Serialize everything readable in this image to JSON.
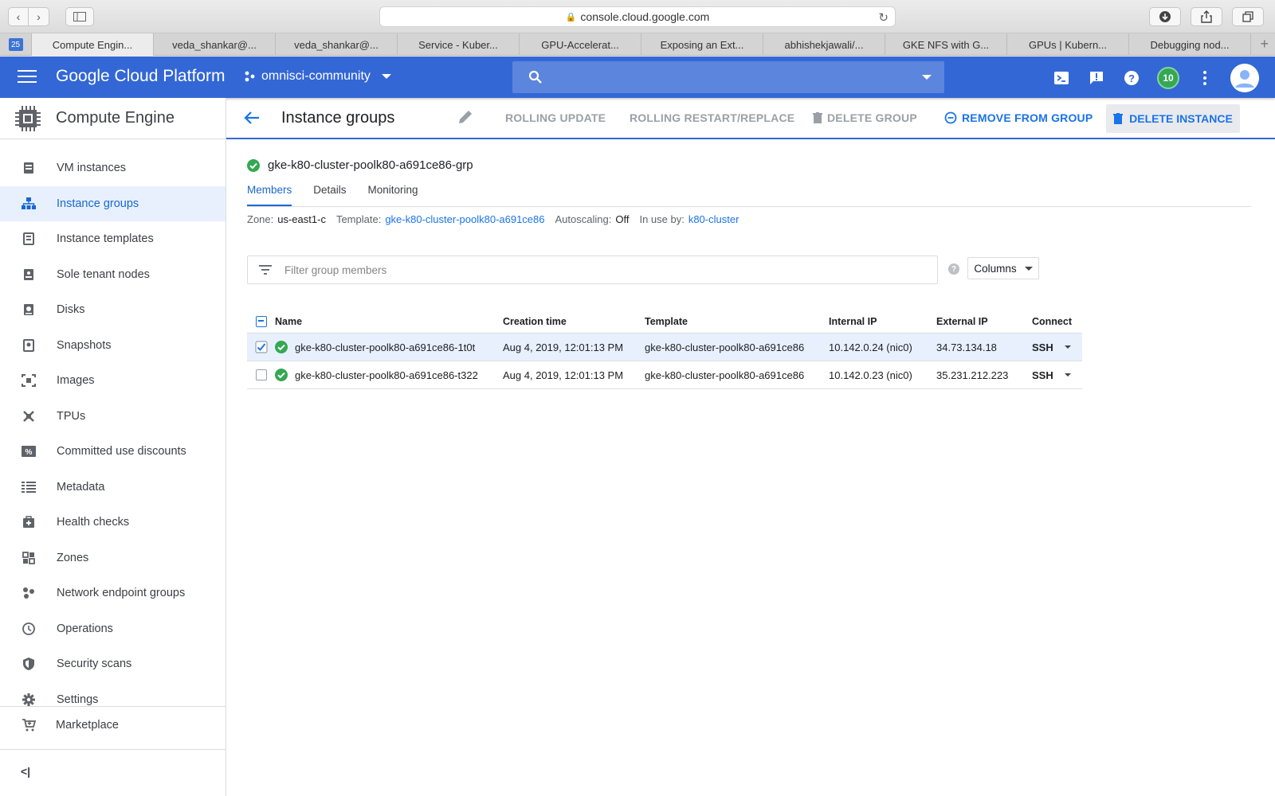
{
  "browser": {
    "url": "console.cloud.google.com",
    "fav_badge": "25",
    "tabs": [
      {
        "label": "Compute Engin..."
      },
      {
        "label": "veda_shankar@..."
      },
      {
        "label": "veda_shankar@..."
      },
      {
        "label": "Service - Kuber..."
      },
      {
        "label": "GPU-Accelerat..."
      },
      {
        "label": "Exposing an Ext..."
      },
      {
        "label": "abhishekjawali/..."
      },
      {
        "label": "GKE NFS with G..."
      },
      {
        "label": "GPUs  |  Kubern..."
      },
      {
        "label": "Debugging nod..."
      }
    ]
  },
  "header": {
    "brand": "Google Cloud Platform",
    "project": "omnisci-community",
    "notification_count": "10",
    "accent_color": "#3367d6"
  },
  "sidebar": {
    "title": "Compute Engine",
    "items": [
      {
        "label": "VM instances",
        "icon": "vm-instances-icon"
      },
      {
        "label": "Instance groups",
        "icon": "instance-groups-icon"
      },
      {
        "label": "Instance templates",
        "icon": "instance-templates-icon"
      },
      {
        "label": "Sole tenant nodes",
        "icon": "sole-tenant-icon"
      },
      {
        "label": "Disks",
        "icon": "disk-icon"
      },
      {
        "label": "Snapshots",
        "icon": "snapshot-icon"
      },
      {
        "label": "Images",
        "icon": "image-icon"
      },
      {
        "label": "TPUs",
        "icon": "tpu-icon"
      },
      {
        "label": "Committed use discounts",
        "icon": "percent-icon"
      },
      {
        "label": "Metadata",
        "icon": "metadata-icon"
      },
      {
        "label": "Health checks",
        "icon": "health-check-icon"
      },
      {
        "label": "Zones",
        "icon": "zones-icon"
      },
      {
        "label": "Network endpoint groups",
        "icon": "network-endpoint-icon"
      },
      {
        "label": "Operations",
        "icon": "clock-icon"
      },
      {
        "label": "Security scans",
        "icon": "shield-icon"
      },
      {
        "label": "Settings",
        "icon": "gear-icon"
      }
    ],
    "marketplace": "Marketplace",
    "collapse": "<|"
  },
  "toolbar": {
    "title": "Instance groups",
    "rolling_update": "ROLLING UPDATE",
    "rolling_restart": "ROLLING RESTART/REPLACE",
    "delete_group": "DELETE GROUP",
    "remove_from_group": "REMOVE FROM GROUP",
    "delete_instance": "DELETE INSTANCE"
  },
  "group": {
    "name": "gke-k80-cluster-poolk80-a691ce86-grp",
    "tabs": [
      "Members",
      "Details",
      "Monitoring"
    ],
    "zone_label": "Zone:",
    "zone": "us-east1-c",
    "template_label": "Template:",
    "template": "gke-k80-cluster-poolk80-a691ce86",
    "autoscaling_label": "Autoscaling:",
    "autoscaling": "Off",
    "in_use_label": "In use by:",
    "in_use": "k80-cluster"
  },
  "filter": {
    "placeholder": "Filter group members",
    "columns_label": "Columns"
  },
  "table": {
    "headers": {
      "name": "Name",
      "creation_time": "Creation time",
      "template": "Template",
      "internal_ip": "Internal IP",
      "external_ip": "External IP",
      "connect": "Connect"
    },
    "rows": [
      {
        "name": "gke-k80-cluster-poolk80-a691ce86-1t0t",
        "creation_time": "Aug 4, 2019, 12:01:13 PM",
        "template": "gke-k80-cluster-poolk80-a691ce86",
        "internal_ip": "10.142.0.24 (nic0)",
        "external_ip": "34.73.134.18",
        "connect": "SSH",
        "checked": true
      },
      {
        "name": "gke-k80-cluster-poolk80-a691ce86-t322",
        "creation_time": "Aug 4, 2019, 12:01:13 PM",
        "template": "gke-k80-cluster-poolk80-a691ce86",
        "internal_ip": "10.142.0.23 (nic0)",
        "external_ip": "35.231.212.223",
        "connect": "SSH",
        "checked": false
      }
    ]
  }
}
